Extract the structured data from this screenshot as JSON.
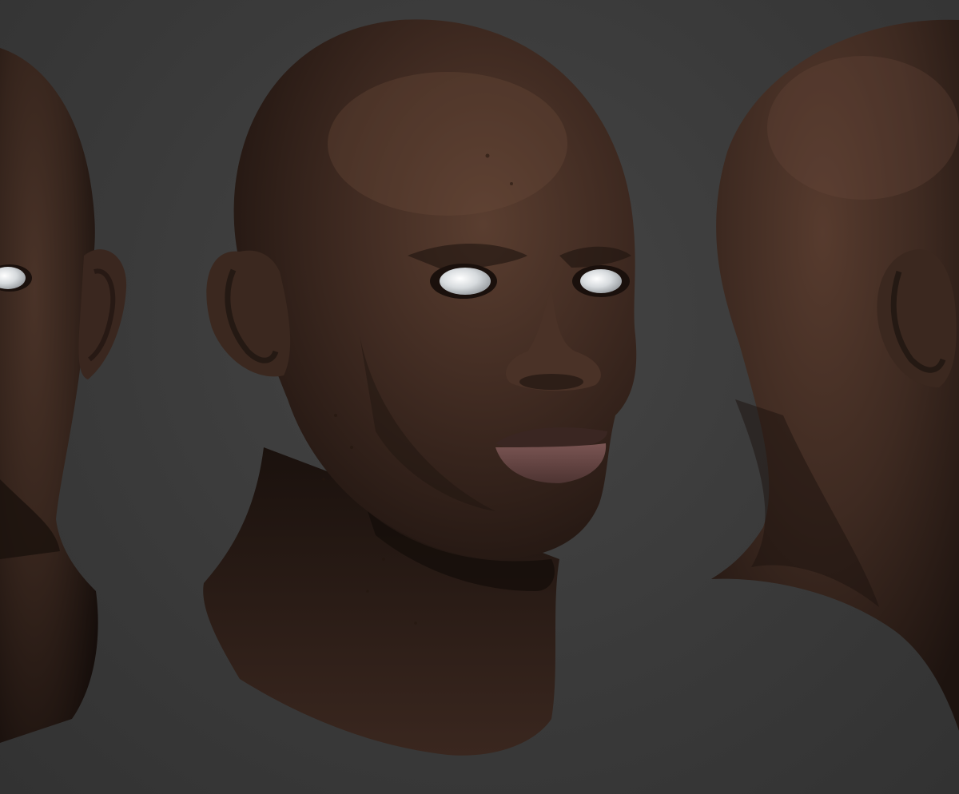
{
  "scene": {
    "background_color": "#3b3b3b",
    "skin_color": "#3e2a21",
    "eye_color": "#d9dde0",
    "lip_color": "#6b4a48",
    "views": [
      {
        "name": "three-quarter-left-partial",
        "visible": true
      },
      {
        "name": "three-quarter-front",
        "visible": true
      },
      {
        "name": "rear-three-quarter",
        "visible": true
      }
    ]
  }
}
